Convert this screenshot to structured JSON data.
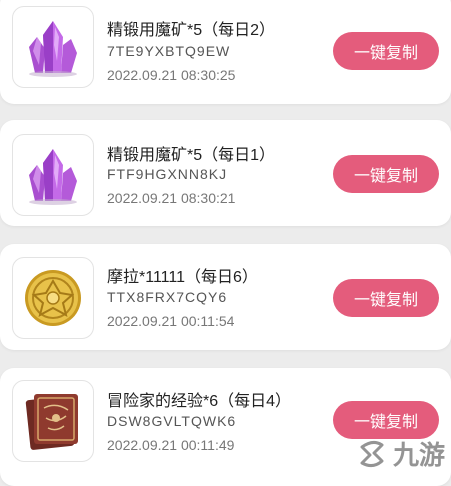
{
  "items": [
    {
      "icon": "purple-crystal-icon",
      "title": "精锻用魔矿*5（每日2）",
      "code": "7TE9YXBTQ9EW",
      "time": "2022.09.21 08:30:25",
      "button_label": "一键复制"
    },
    {
      "icon": "purple-crystal-icon",
      "title": "精锻用魔矿*5（每日1）",
      "code": "FTF9HGXNN8KJ",
      "time": "2022.09.21 08:30:21",
      "button_label": "一键复制"
    },
    {
      "icon": "gold-coin-icon",
      "title": "摩拉*11111（每日6）",
      "code": "TTX8FRX7CQY6",
      "time": "2022.09.21 00:11:54",
      "button_label": "一键复制"
    },
    {
      "icon": "red-book-icon",
      "title": "冒险家的经验*6（每日4）",
      "code": "DSW8GVLTQWK6",
      "time": "2022.09.21 00:11:49",
      "button_label": "一键复制"
    }
  ],
  "watermark": {
    "text": "九游",
    "icon": "jiuyou-logo-icon"
  },
  "colors": {
    "button": "#e45c7c",
    "background": "#ececec",
    "card": "#ffffff"
  }
}
